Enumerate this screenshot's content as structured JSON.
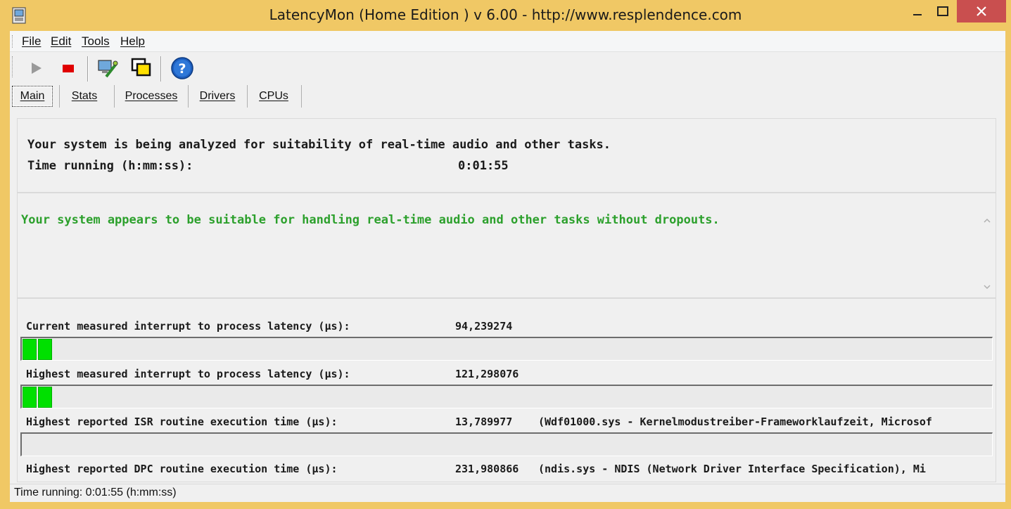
{
  "window": {
    "title": "LatencyMon  (Home Edition )  v 6.00 - http://www.resplendence.com",
    "minimize_icon": "minimize-icon",
    "maximize_icon": "maximize-icon",
    "close_icon": "close-icon",
    "app_icon": "latencymon-app-icon"
  },
  "menu": {
    "items": [
      "File",
      "Edit",
      "Tools",
      "Help"
    ]
  },
  "toolbar": {
    "buttons": [
      {
        "icon": "play-icon",
        "enabled": false
      },
      {
        "icon": "stop-icon",
        "enabled": true
      },
      {
        "icon": "tools-icon",
        "enabled": true
      },
      {
        "icon": "windows-icon",
        "enabled": true
      },
      {
        "icon": "help-icon",
        "enabled": true
      }
    ]
  },
  "tabs": {
    "items": [
      "Main",
      "Stats",
      "Processes",
      "Drivers",
      "CPUs"
    ],
    "active": "Main"
  },
  "status_panel": {
    "line1": "Your system is being analyzed for suitability of real-time audio and other tasks.",
    "time_label": "Time running (h:mm:ss):",
    "time_value": "0:01:55"
  },
  "verdict": {
    "text": "Your system appears to be suitable for handling real-time audio and other tasks without dropouts.",
    "color": "#2ca02c"
  },
  "metrics": [
    {
      "label": "Current measured interrupt to process latency (µs):",
      "value": "94,239274",
      "detail": "",
      "segments": 2
    },
    {
      "label": "Highest measured interrupt to process latency (µs):",
      "value": "121,298076",
      "detail": "",
      "segments": 2
    },
    {
      "label": "Highest reported ISR routine execution time (µs):",
      "value": "13,789977",
      "detail": "(Wdf01000.sys - Kernelmodustreiber-Frameworklaufzeit, Microsof",
      "segments": 0
    },
    {
      "label": "Highest reported DPC routine execution time (µs):",
      "value": "231,980866",
      "detail": "(ndis.sys - NDIS (Network Driver Interface Specification), Mi",
      "segments": 0
    }
  ],
  "statusbar": {
    "text": "Time running: 0:01:55  (h:mm:ss)"
  },
  "colors": {
    "frame": "#f0c865",
    "close_button": "#c94f4f",
    "bar_fill": "#00e000",
    "verdict_green": "#2ca02c"
  }
}
